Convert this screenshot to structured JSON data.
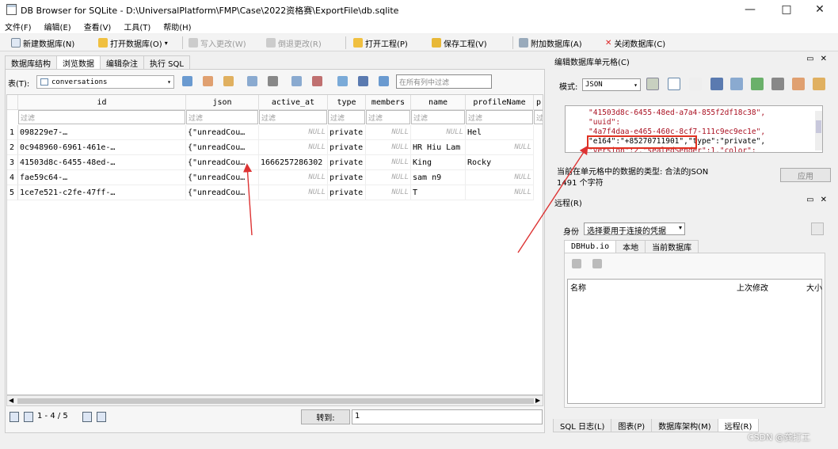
{
  "window": {
    "title": "DB Browser for SQLite - D:\\UniversalPlatform\\FMP\\Case\\2022资格赛\\ExportFile\\db.sqlite"
  },
  "menu": [
    "文件(F)",
    "编辑(E)",
    "查看(V)",
    "工具(T)",
    "帮助(H)"
  ],
  "toolbar": {
    "new_db": "新建数据库(N)",
    "open_db": "打开数据库(O)",
    "write_changes": "写入更改(W)",
    "revert_changes": "倒退更改(R)",
    "open_project": "打开工程(P)",
    "save_project": "保存工程(V)",
    "attach_db": "附加数据库(A)",
    "close_db": "关闭数据库(C)"
  },
  "tabs": [
    "数据库结构",
    "浏览数据",
    "编辑杂注",
    "执行 SQL"
  ],
  "browse": {
    "table_label": "表(T):",
    "table_name": "conversations",
    "filter_all_placeholder": "在所有列中过滤",
    "filter_placeholder": "过滤",
    "columns": [
      "id",
      "json",
      "active_at",
      "type",
      "members",
      "name",
      "profileName",
      "p"
    ],
    "null_text": "NULL",
    "rows": [
      {
        "n": "1",
        "id": "098229e7-…",
        "json": "{\"unreadCou…",
        "active_at": "NULL",
        "type": "private",
        "members": "NULL",
        "name": "NULL",
        "profileName": "Hel"
      },
      {
        "n": "2",
        "id": "0c948960-6961-461e-…",
        "json": "{\"unreadCou…",
        "active_at": "NULL",
        "type": "private",
        "members": "NULL",
        "name": "HR Hiu Lam",
        "profileName": "NULL"
      },
      {
        "n": "3",
        "id": "41503d8c-6455-48ed-…",
        "json": "{\"unreadCou…",
        "active_at": "1666257286302",
        "type": "private",
        "members": "NULL",
        "name": "King",
        "profileName": "Rocky"
      },
      {
        "n": "4",
        "id": "fae59c64-…",
        "json": "{\"unreadCou…",
        "active_at": "NULL",
        "type": "private",
        "members": "NULL",
        "name": "sam n9",
        "profileName": "NULL"
      },
      {
        "n": "5",
        "id": "1ce7e521-c2fe-47ff-…",
        "json": "{\"unreadCou…",
        "active_at": "NULL",
        "type": "private",
        "members": "NULL",
        "name": "T",
        "profileName": "NULL"
      }
    ],
    "page_info": "1 - 4 / 5",
    "goto_label": "转到:",
    "goto_value": "1"
  },
  "cell_editor": {
    "title": "编辑数据库单元格(C)",
    "mode_label": "模式:",
    "mode": "JSON",
    "lines": [
      "\"41503d8c-6455-48ed-a7a4-855f2df18c38\",",
      "\"uuid\":",
      "\"4a7f4daa-e465-460c-8cf7-111c9ec9ec1e\",",
      "\"e164\":\"+85270711901\",\"type\":\"private\",",
      "\"version\":2,\"sealedSender\":1,\"color\":"
    ],
    "type_info": "当前在单元格中的数据的类型: 合法的JSON",
    "char_count": "1491 个字符",
    "apply": "应用"
  },
  "remote": {
    "title": "远程(R)",
    "identity_label": "身份",
    "identity_value": "选择要用于连接的凭据",
    "tabs": [
      "DBHub.io",
      "本地",
      "当前数据库"
    ],
    "col_name": "名称",
    "col_modified": "上次修改",
    "col_size": "大小"
  },
  "bottom_tabs": [
    "SQL 日志(L)",
    "图表(P)",
    "数据库架构(M)",
    "远程(R)"
  ],
  "watermark": "CSDN @龚打工",
  "colors": {
    "highlight": "#e03020",
    "json_string": "#a12"
  }
}
